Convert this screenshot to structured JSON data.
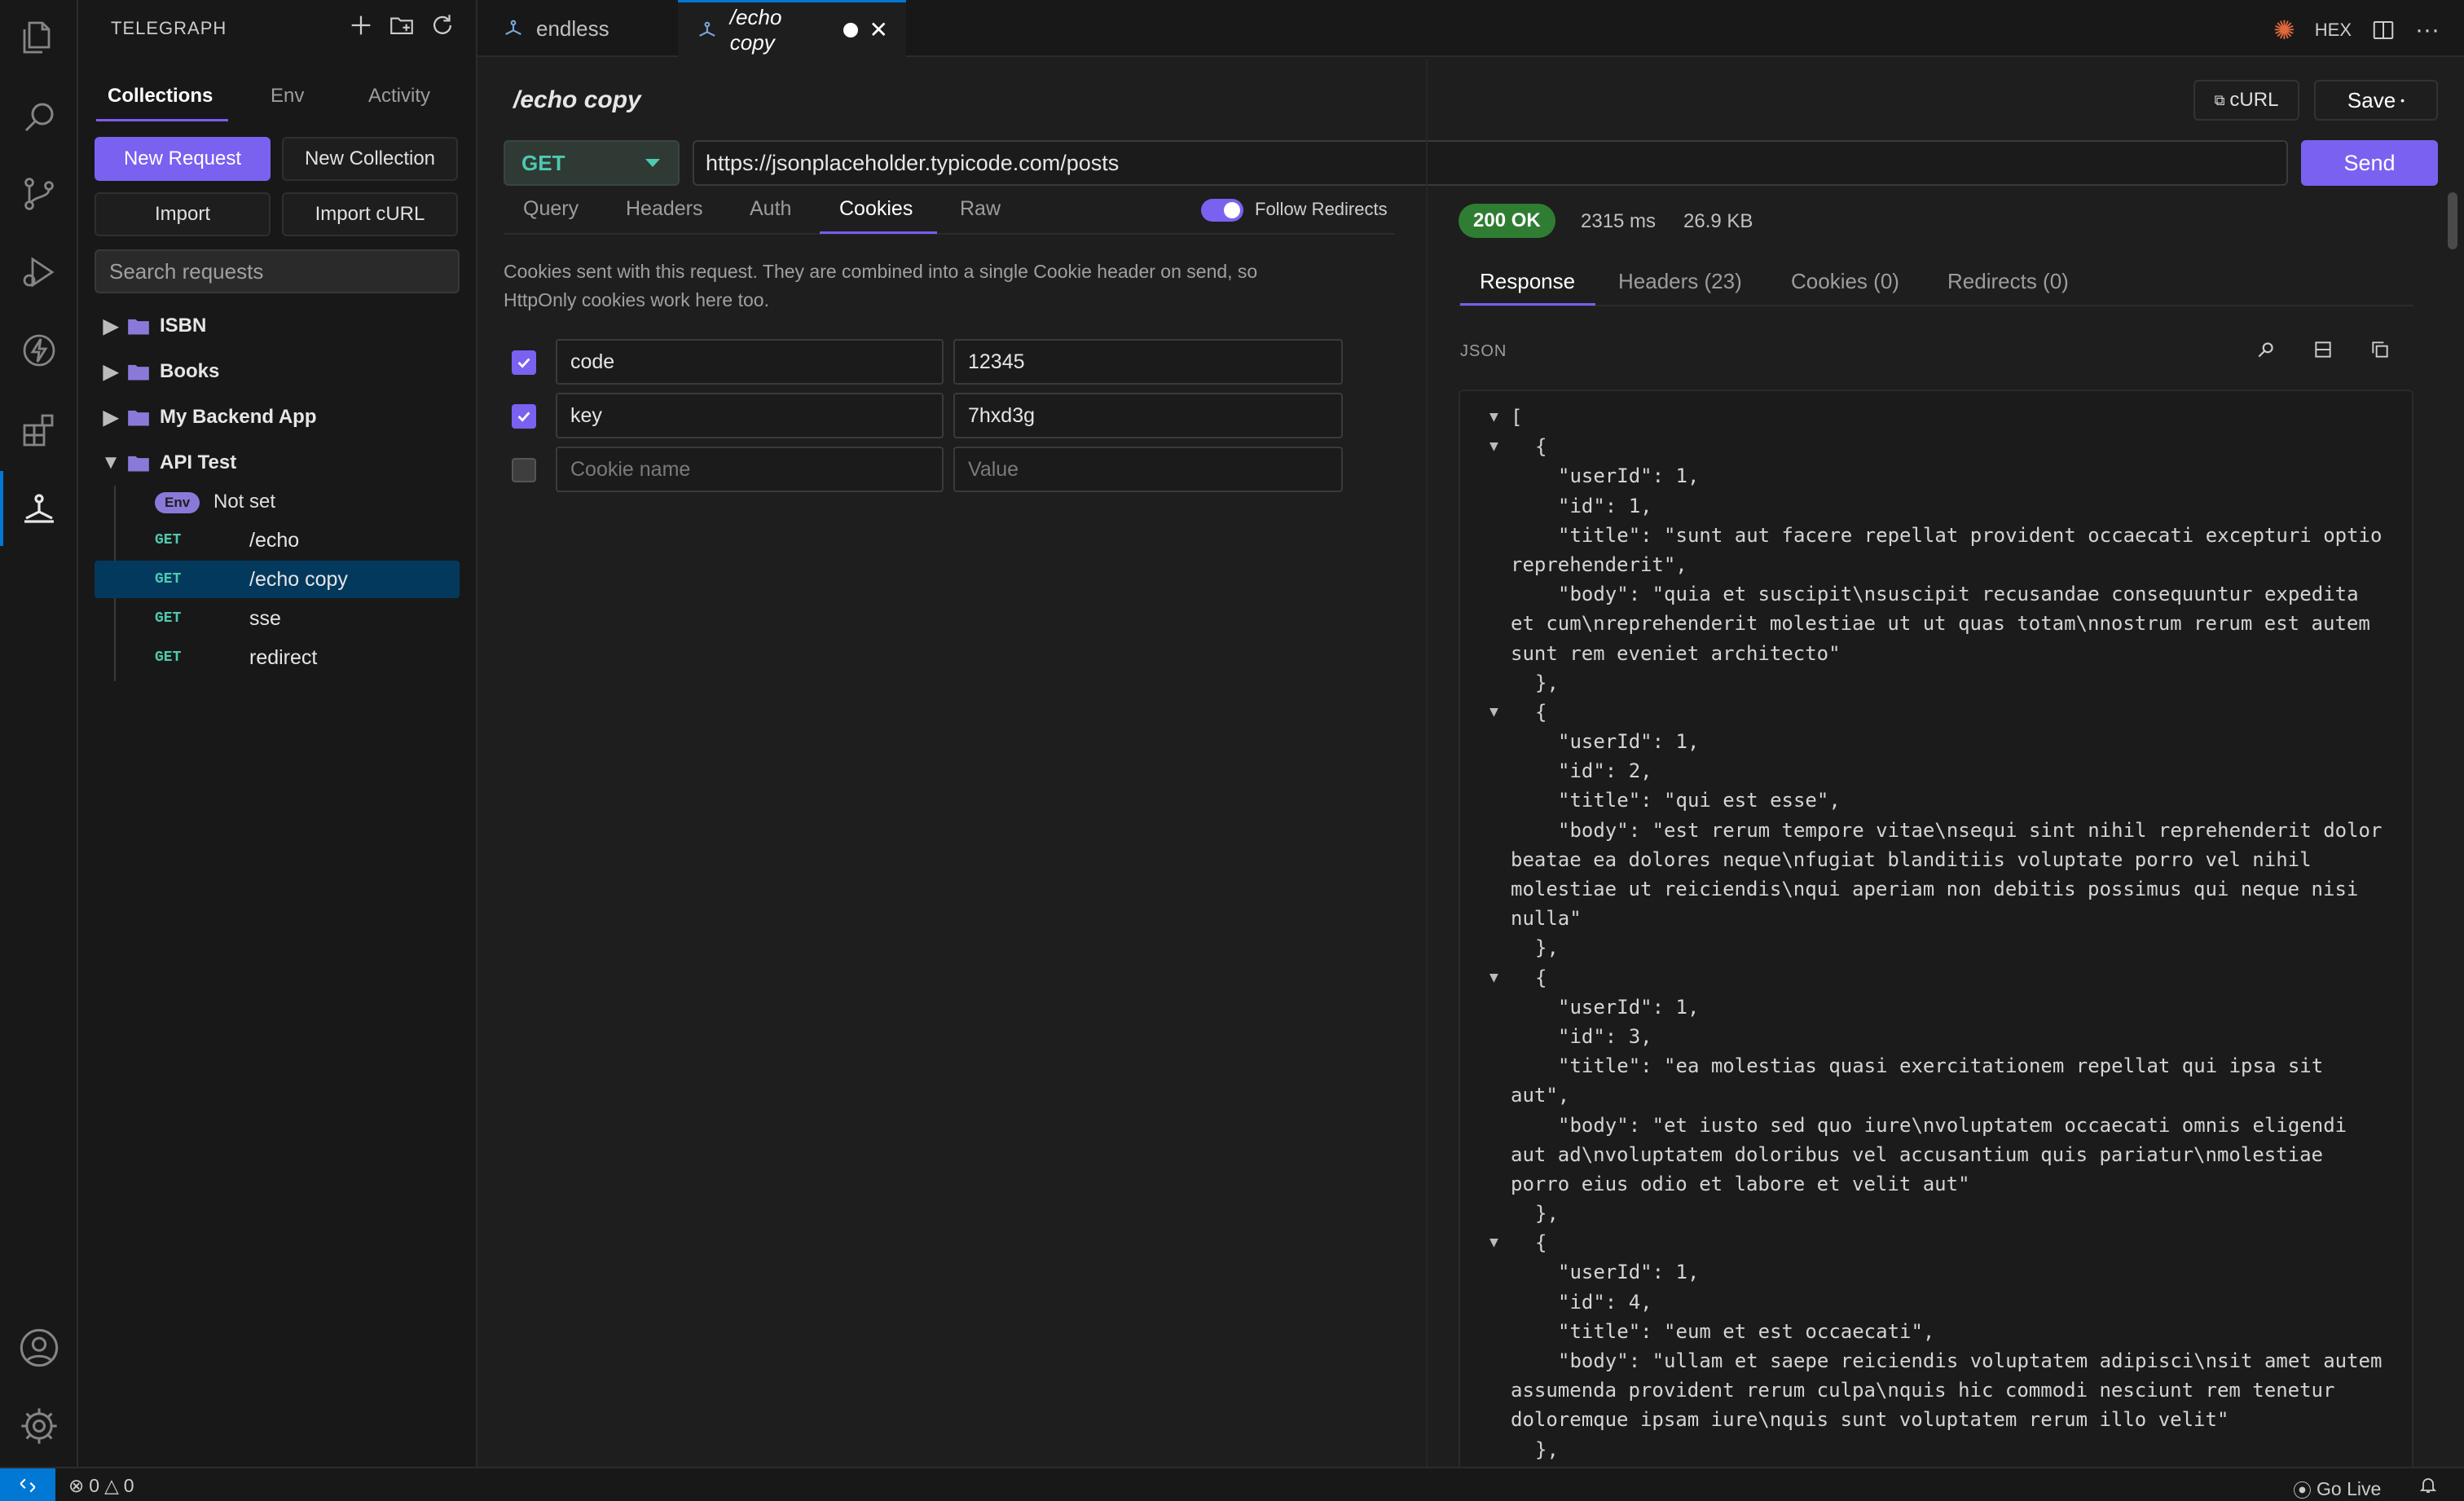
{
  "app": {
    "sidebar_title": "TELEGRAPH"
  },
  "sidebar": {
    "tabs": [
      "Collections",
      "Env",
      "Activity"
    ],
    "buttons": {
      "new_request": "New Request",
      "new_collection": "New Collection",
      "import": "Import",
      "import_curl": "Import cURL"
    },
    "search_placeholder": "Search requests",
    "folders": [
      {
        "name": "ISBN",
        "expanded": false
      },
      {
        "name": "Books",
        "expanded": false
      },
      {
        "name": "My Backend App",
        "expanded": false
      },
      {
        "name": "API Test",
        "expanded": true
      }
    ],
    "env": {
      "badge": "Env",
      "value": "Not set"
    },
    "requests": [
      {
        "method": "GET",
        "name": "/echo"
      },
      {
        "method": "GET",
        "name": "/echo copy",
        "selected": true
      },
      {
        "method": "GET",
        "name": "sse"
      },
      {
        "method": "GET",
        "name": "redirect"
      }
    ]
  },
  "editor_tabs": [
    {
      "label": "endless"
    },
    {
      "label": "/echo copy",
      "modified": true
    }
  ],
  "top_tools": {
    "hex_label": "HEX"
  },
  "request": {
    "title": "/echo copy",
    "curl_label": "cURL",
    "save_label": "Save",
    "method": "GET",
    "url": "https://jsonplaceholder.typicode.com/posts",
    "send_label": "Send",
    "tabs": [
      "Query",
      "Headers",
      "Auth",
      "Cookies",
      "Raw"
    ],
    "follow_redirects_label": "Follow Redirects",
    "follow_redirects": true,
    "cookies_desc_1": "Cookies sent with this request. They are combined into a single Cookie header on send, so",
    "cookies_desc_2": "HttpOnly cookies work here too.",
    "cookies": [
      {
        "enabled": true,
        "name": "code",
        "value": "12345"
      },
      {
        "enabled": true,
        "name": "key",
        "value": "7hxd3g"
      }
    ],
    "new_cookie": {
      "name_placeholder": "Cookie name",
      "value_placeholder": "Value"
    }
  },
  "response": {
    "status": "200 OK",
    "time": "2315 ms",
    "size": "26.9 KB",
    "tabs": [
      "Response",
      "Headers (23)",
      "Cookies (0)",
      "Redirects (0)"
    ],
    "format_label": "JSON",
    "json_lines": [
      {
        "tri": true,
        "indent": 0,
        "text": "["
      },
      {
        "tri": true,
        "indent": 1,
        "text": "{"
      },
      {
        "indent": 2,
        "text": "\"userId\": 1,"
      },
      {
        "indent": 2,
        "text": "\"id\": 1,"
      },
      {
        "indent": 2,
        "text": "\"title\": \"sunt aut facere repellat provident occaecati excepturi optio"
      },
      {
        "indent": 0,
        "text": "reprehenderit\","
      },
      {
        "indent": 2,
        "text": "\"body\": \"quia et suscipit\\nsuscipit recusandae consequuntur expedita"
      },
      {
        "indent": 0,
        "text": "et cum\\nreprehenderit molestiae ut ut quas totam\\nnostrum rerum est autem"
      },
      {
        "indent": 0,
        "text": "sunt rem eveniet architecto\""
      },
      {
        "indent": 1,
        "text": "},"
      },
      {
        "tri": true,
        "indent": 1,
        "text": "{"
      },
      {
        "indent": 2,
        "text": "\"userId\": 1,"
      },
      {
        "indent": 2,
        "text": "\"id\": 2,"
      },
      {
        "indent": 2,
        "text": "\"title\": \"qui est esse\","
      },
      {
        "indent": 2,
        "text": "\"body\": \"est rerum tempore vitae\\nsequi sint nihil reprehenderit dolor"
      },
      {
        "indent": 0,
        "text": "beatae ea dolores neque\\nfugiat blanditiis voluptate porro vel nihil"
      },
      {
        "indent": 0,
        "text": "molestiae ut reiciendis\\nqui aperiam non debitis possimus qui neque nisi"
      },
      {
        "indent": 0,
        "text": "nulla\""
      },
      {
        "indent": 1,
        "text": "},"
      },
      {
        "tri": true,
        "indent": 1,
        "text": "{"
      },
      {
        "indent": 2,
        "text": "\"userId\": 1,"
      },
      {
        "indent": 2,
        "text": "\"id\": 3,"
      },
      {
        "indent": 2,
        "text": "\"title\": \"ea molestias quasi exercitationem repellat qui ipsa sit"
      },
      {
        "indent": 0,
        "text": "aut\","
      },
      {
        "indent": 2,
        "text": "\"body\": \"et iusto sed quo iure\\nvoluptatem occaecati omnis eligendi"
      },
      {
        "indent": 0,
        "text": "aut ad\\nvoluptatem doloribus vel accusantium quis pariatur\\nmolestiae"
      },
      {
        "indent": 0,
        "text": "porro eius odio et labore et velit aut\""
      },
      {
        "indent": 1,
        "text": "},"
      },
      {
        "tri": true,
        "indent": 1,
        "text": "{"
      },
      {
        "indent": 2,
        "text": "\"userId\": 1,"
      },
      {
        "indent": 2,
        "text": "\"id\": 4,"
      },
      {
        "indent": 2,
        "text": "\"title\": \"eum et est occaecati\","
      },
      {
        "indent": 2,
        "text": "\"body\": \"ullam et saepe reiciendis voluptatem adipisci\\nsit amet autem"
      },
      {
        "indent": 0,
        "text": "assumenda provident rerum culpa\\nquis hic commodi nesciunt rem tenetur"
      },
      {
        "indent": 0,
        "text": "doloremque ipsam iure\\nquis sunt voluptatem rerum illo velit\""
      },
      {
        "indent": 1,
        "text": "},"
      }
    ]
  },
  "statusbar": {
    "errors": "0",
    "warnings": "0",
    "go_live": "Go Live"
  },
  "colors": {
    "accent": "#7b61f0",
    "success": "#2f7d32",
    "method_get": "#4ec9b0",
    "selected_row": "#04395e",
    "vscode_blue": "#0078d4"
  }
}
